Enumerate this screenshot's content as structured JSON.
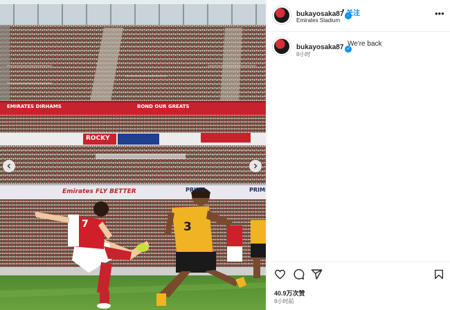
{
  "photo": {
    "ad_boards": {
      "upper_left": "EMIRATES DIRHAMS",
      "upper_mid": "BOND OUR GREATS",
      "mid_right": "ROCKY",
      "lower_banner": "Emirates FLY BETTER",
      "lower_right_1": "PRIME",
      "lower_right_2": "PRIME"
    },
    "players": {
      "arsenal_number": "7",
      "wolves_number": "3"
    }
  },
  "header": {
    "username": "bukayosaka87",
    "verified_mark": "✓",
    "separator": "•",
    "follow_label": "关注",
    "location": "Emirates Stadium",
    "more_label": "•••"
  },
  "caption": {
    "username": "bukayosaka87",
    "verified_mark": "✓",
    "text": "We're back",
    "time": "8小时"
  },
  "actions": {
    "icons": [
      "heart-icon",
      "comment-icon",
      "share-icon",
      "bookmark-icon"
    ],
    "likes": "40.9万次赞",
    "time": "8小时前"
  },
  "colors": {
    "verified": "#0095f6",
    "follow": "#0095f6",
    "arsenal_red": "#d01f2a",
    "wolves_gold": "#f0b323"
  }
}
